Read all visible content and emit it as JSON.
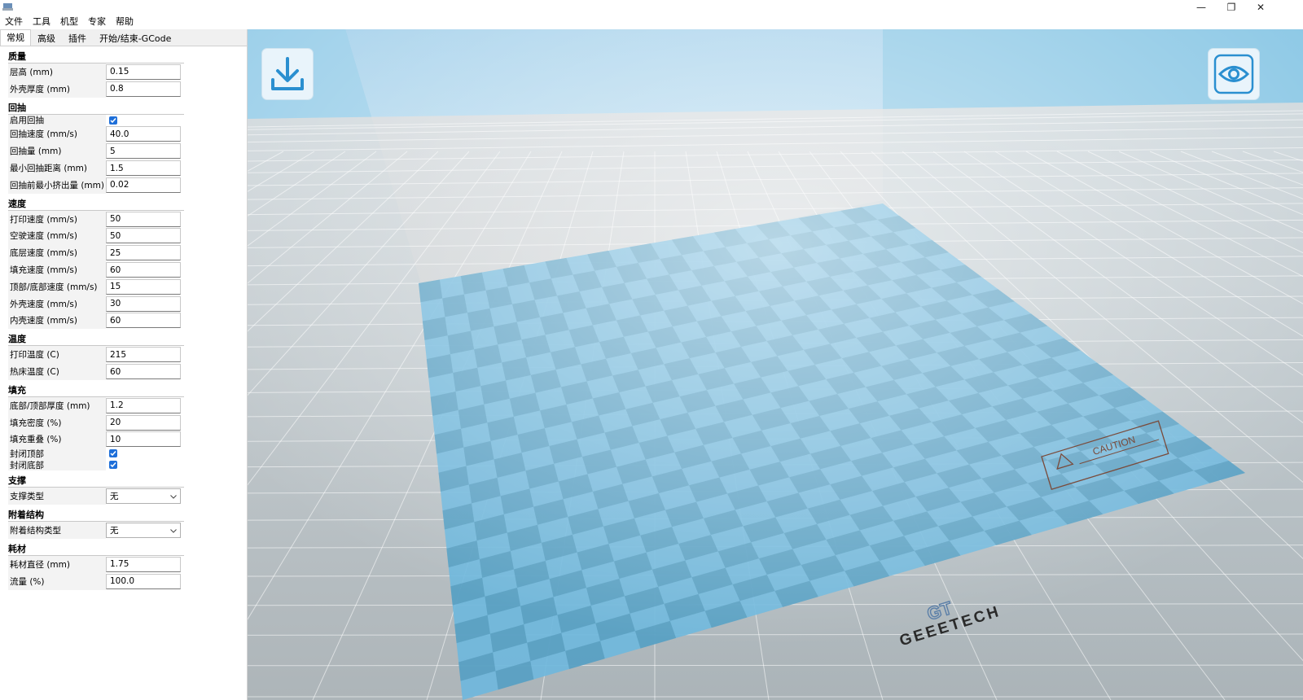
{
  "window": {
    "minimize": "—",
    "restore": "❐",
    "close": "✕"
  },
  "menu": [
    "文件",
    "工具",
    "机型",
    "专家",
    "帮助"
  ],
  "tabs": [
    "常规",
    "高级",
    "插件",
    "开始/结束-GCode"
  ],
  "sections": [
    {
      "title": "质量",
      "rows": [
        {
          "label": "层高 (mm)",
          "value": "0.15"
        },
        {
          "label": "外壳厚度 (mm)",
          "value": "0.8"
        }
      ]
    },
    {
      "title": "回抽",
      "rows": [
        {
          "label": "启用回抽",
          "checkbox": true
        },
        {
          "label": "回抽速度 (mm/s)",
          "value": "40.0"
        },
        {
          "label": "回抽量 (mm)",
          "value": "5"
        },
        {
          "label": "最小回抽距离 (mm)",
          "value": "1.5"
        },
        {
          "label": "回抽前最小挤出量 (mm)",
          "value": "0.02"
        }
      ]
    },
    {
      "title": "速度",
      "rows": [
        {
          "label": "打印速度 (mm/s)",
          "value": "50"
        },
        {
          "label": "空驶速度 (mm/s)",
          "value": "50"
        },
        {
          "label": "底层速度 (mm/s)",
          "value": "25"
        },
        {
          "label": "填充速度 (mm/s)",
          "value": "60"
        },
        {
          "label": "顶部/底部速度 (mm/s)",
          "value": "15"
        },
        {
          "label": "外壳速度 (mm/s)",
          "value": "30"
        },
        {
          "label": "内壳速度  (mm/s)",
          "value": "60"
        }
      ]
    },
    {
      "title": "温度",
      "rows": [
        {
          "label": "打印温度 (C)",
          "value": "215"
        },
        {
          "label": "热床温度 (C)",
          "value": "60"
        }
      ]
    },
    {
      "title": "填充",
      "rows": [
        {
          "label": "底部/顶部厚度 (mm)",
          "value": "1.2"
        },
        {
          "label": "填充密度 (%)",
          "value": "20"
        },
        {
          "label": "填充重叠 (%)",
          "value": "10"
        },
        {
          "label": "封闭顶部",
          "checkbox": true
        },
        {
          "label": "封闭底部",
          "checkbox": true
        }
      ]
    },
    {
      "title": "支撑",
      "rows": [
        {
          "label": "支撑类型",
          "select": "无"
        }
      ]
    },
    {
      "title": "附着结构",
      "rows": [
        {
          "label": "附着结构类型",
          "select": "无"
        }
      ]
    },
    {
      "title": "耗材",
      "rows": [
        {
          "label": "耗材直径 (mm)",
          "value": "1.75"
        },
        {
          "label": "流量 (%)",
          "value": "100.0"
        }
      ]
    }
  ],
  "viewport": {
    "bed_logo": "GEEETECH",
    "bed_logo_mark": "GT",
    "caution_label": "CAUTION",
    "load_icon": "download-icon",
    "view_icon": "eye-icon",
    "accent": "#2a8fd0"
  }
}
